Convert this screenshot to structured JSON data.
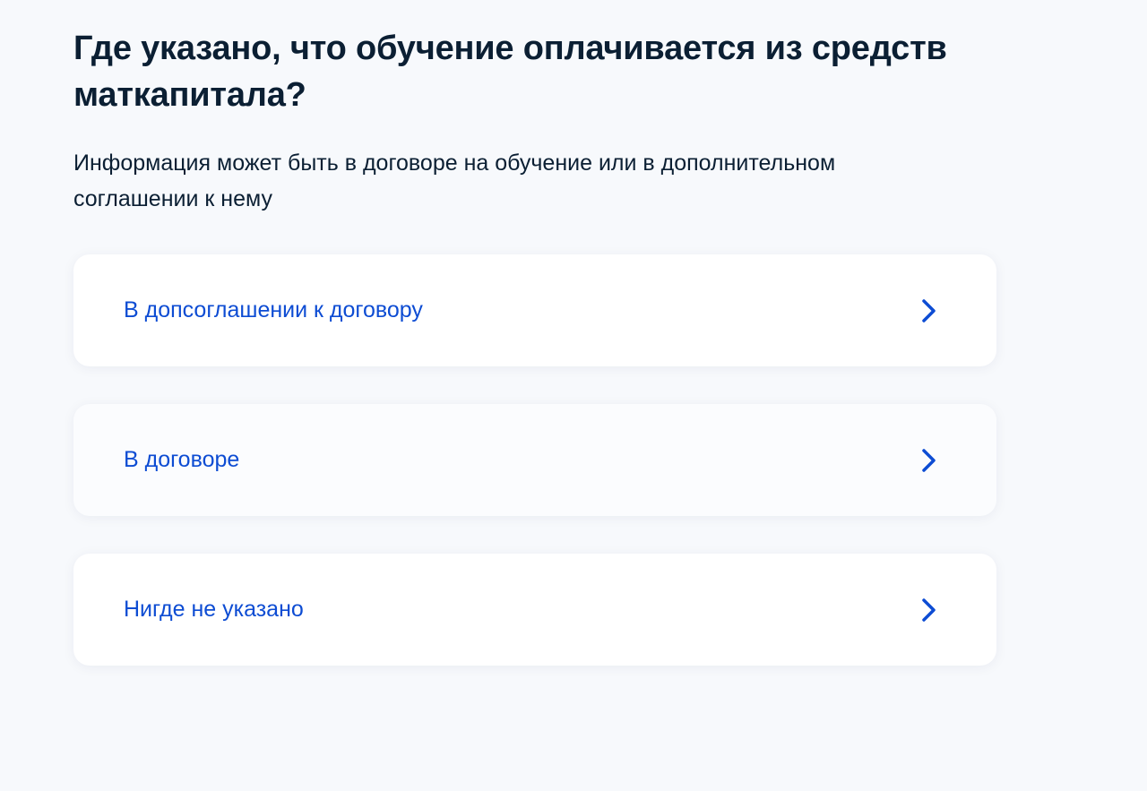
{
  "question": {
    "title": "Где указано, что обучение оплачивается из средств маткапитала?",
    "subtitle": "Информация может быть в договоре на обучение или в дополнительном соглашении к нему"
  },
  "options": [
    {
      "label": "В допсоглашении к договору",
      "icon": "chevron-right-icon"
    },
    {
      "label": "В договоре",
      "icon": "chevron-right-icon"
    },
    {
      "label": "Нигде не указано",
      "icon": "chevron-right-icon"
    }
  ],
  "colors": {
    "accent": "#0d4cd3",
    "text": "#0b1f33",
    "background": "#f7f9fc",
    "card": "#ffffff"
  }
}
